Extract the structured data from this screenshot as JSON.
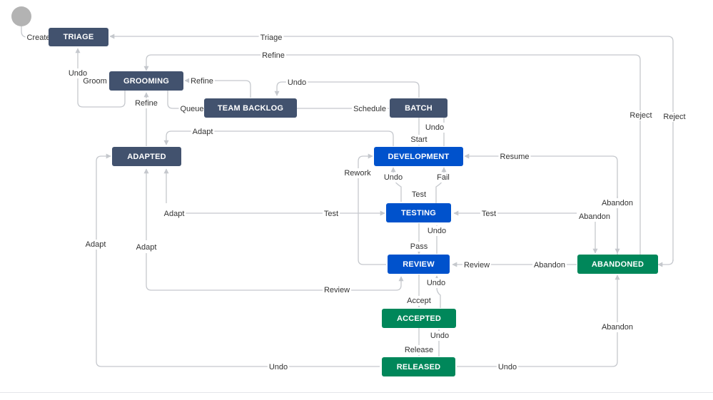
{
  "colors": {
    "todo": "#42526e",
    "inprogress": "#0052cc",
    "done": "#00875a",
    "start_node": "#b3b3b3",
    "edge": "#c5c8cd"
  },
  "states": {
    "triage": "TRIAGE",
    "grooming": "GROOMING",
    "team_backlog": "TEAM BACKLOG",
    "batch": "BATCH",
    "adapted": "ADAPTED",
    "development": "DEVELOPMENT",
    "testing": "TESTING",
    "review": "REVIEW",
    "accepted": "ACCEPTED",
    "released": "RELEASED",
    "abandoned": "ABANDONED"
  },
  "transitions": {
    "create": "Create",
    "triage": "Triage",
    "refine_top": "Refine",
    "undo_grooming": "Undo",
    "groom": "Groom",
    "refine_grooming": "Refine",
    "undo_batch": "Undo",
    "queue": "Queue",
    "schedule": "Schedule",
    "refine_adapted": "Refine",
    "adapt_top": "Adapt",
    "undo_batch_dev": "Undo",
    "start": "Start",
    "reject_1": "Reject",
    "reject_2": "Reject",
    "resume": "Resume",
    "rework": "Rework",
    "undo_test": "Undo",
    "fail": "Fail",
    "test_dev": "Test",
    "abandon_dev": "Abandon",
    "adapt_left": "Adapt",
    "test_adapted": "Test",
    "test_abandoned": "Test",
    "abandon_test": "Abandon",
    "adapt_outer": "Adapt",
    "adapt_inner": "Adapt",
    "undo_review": "Undo",
    "pass": "Pass",
    "review_abandoned": "Review",
    "abandon_review": "Abandon",
    "review_adapted": "Review",
    "undo_accepted": "Undo",
    "accept": "Accept",
    "undo_released": "Undo",
    "release": "Release",
    "abandon_released": "Abandon",
    "undo_bottom": "Undo",
    "undo_abandoned": "Undo"
  }
}
